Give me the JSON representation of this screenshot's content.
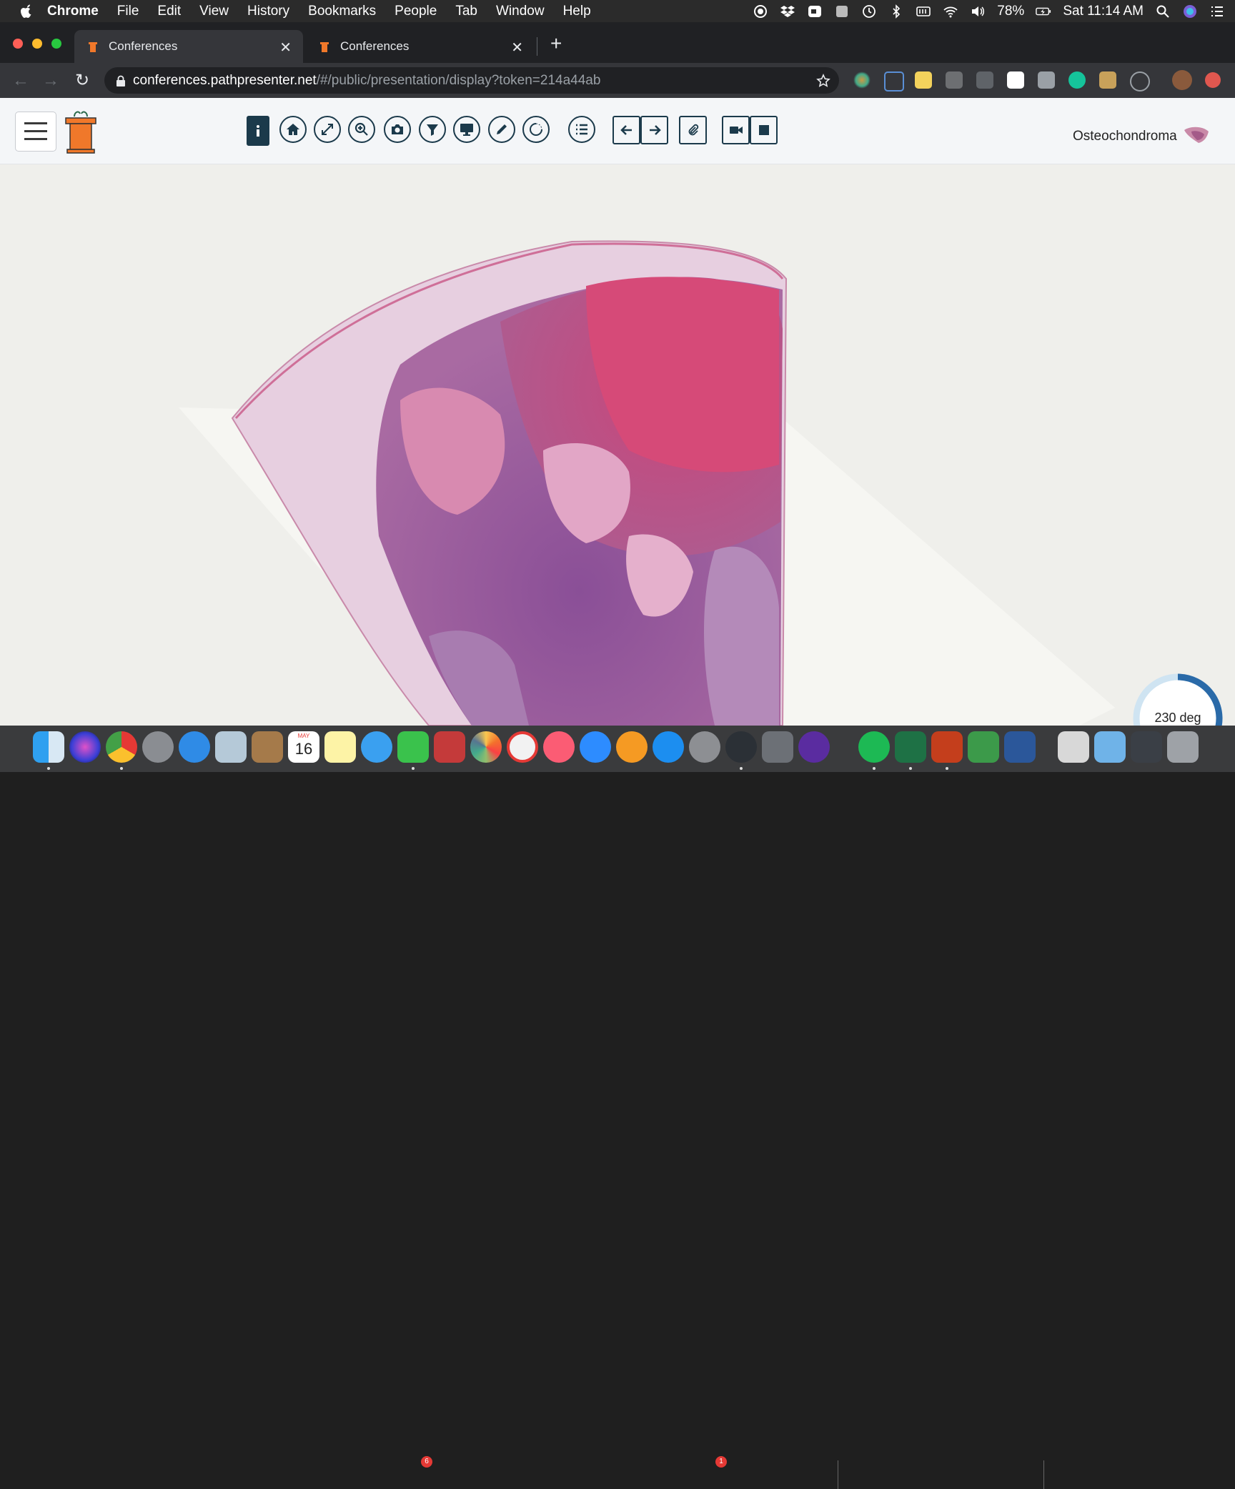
{
  "menubar": {
    "app": "Chrome",
    "items": [
      "File",
      "Edit",
      "View",
      "History",
      "Bookmarks",
      "People",
      "Tab",
      "Window",
      "Help"
    ],
    "battery": "78%",
    "clock": "Sat 11:14 AM"
  },
  "browser": {
    "tabs": [
      {
        "title": "Conferences",
        "active": true
      },
      {
        "title": "Conferences",
        "active": false
      }
    ],
    "url_host": "conferences.pathpresenter.net",
    "url_path": "/#/public/presentation/display?token=214a44ab"
  },
  "app": {
    "slide_title": "Osteochondroma",
    "toolbar_buttons": [
      "info",
      "home",
      "fullscreen",
      "zoom",
      "camera",
      "filter",
      "monitor",
      "pencil",
      "rotate",
      "list",
      "arrow-left",
      "arrow-right",
      "paperclip",
      "video",
      "stop"
    ]
  },
  "viewer": {
    "rotation_label": "230 deg",
    "rotation_degrees": 230
  },
  "dock": {
    "calendar_month": "MAY",
    "calendar_day": "16",
    "facetime_badge": "6",
    "system_prefs_badge": "1"
  },
  "colors": {
    "accent": "#1b3a4b",
    "stain_pink": "#d98ab0",
    "stain_purple": "#8e5a9a",
    "rotation_ring": "#2a6aa8"
  }
}
